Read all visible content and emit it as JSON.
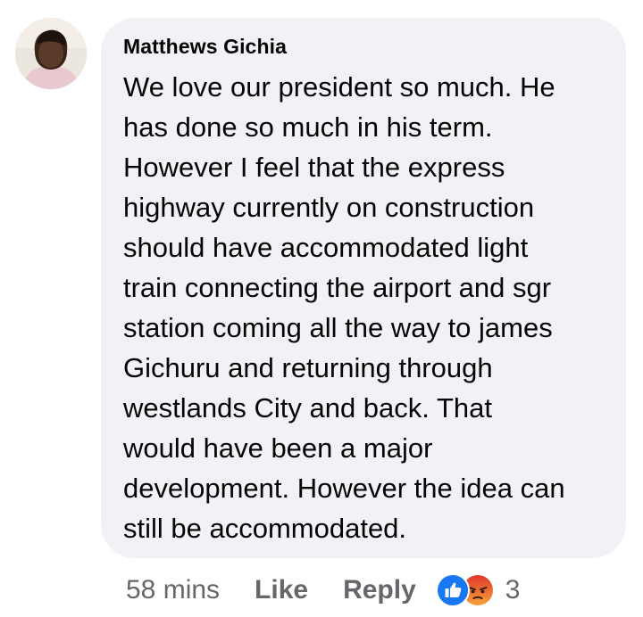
{
  "comment": {
    "author": "Matthews Gichia",
    "text": "We love our president so much. He\nhas done so much in his term.\nHowever I feel that the express\nhighway currently on construction\nshould have accommodated light\ntrain connecting the airport and sgr\nstation coming all the way to james\nGichuru and returning through\nwestlands  City and back. That\nwould have been a major\ndevelopment. However the idea can\nstill be accommodated."
  },
  "actions": {
    "timestamp": "58 mins",
    "like_label": "Like",
    "reply_label": "Reply",
    "reaction_count": "3",
    "reaction_icons": [
      "like-icon",
      "angry-icon"
    ]
  },
  "colors": {
    "bubble_bg": "#f0f2f5",
    "text": "#050505",
    "secondary_text": "#65676b",
    "like_blue": "#1877f2",
    "angry_orange": "#f0702c"
  }
}
